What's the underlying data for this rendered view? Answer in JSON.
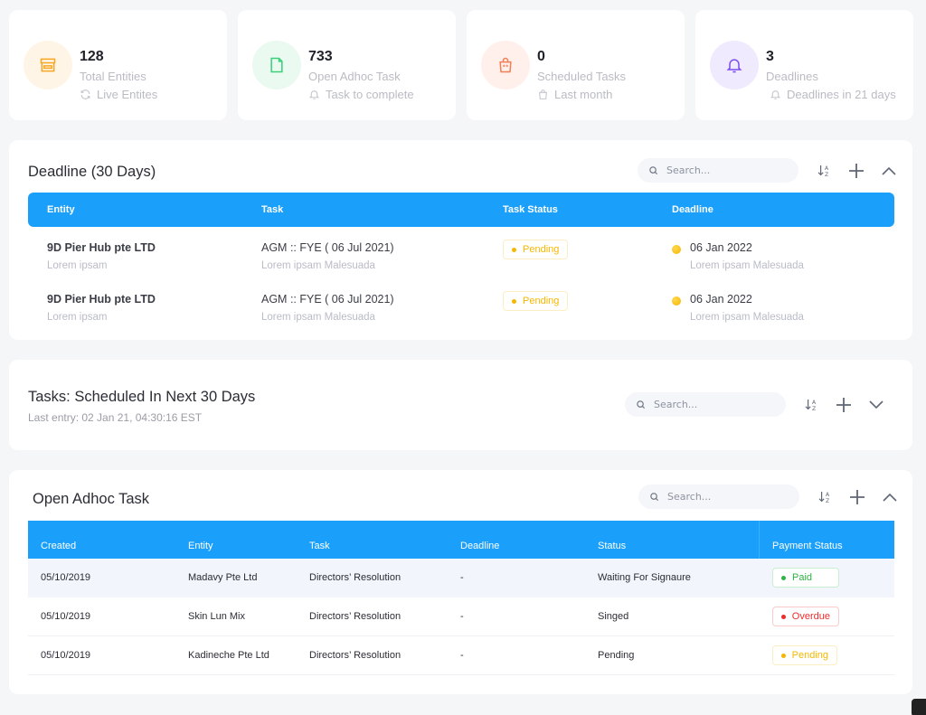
{
  "stats": [
    {
      "value": "128",
      "label": "Total Entities",
      "sub": "Live Entites",
      "icon": "store-icon",
      "sub_icon": "refresh-icon",
      "color": "#f6a623",
      "bg": "#fff5e6"
    },
    {
      "value": "733",
      "label": "Open Adhoc Task",
      "sub": "Task to complete",
      "icon": "file-icon",
      "sub_icon": "bell-icon",
      "color": "#3ccf7a",
      "bg": "#eafaf0"
    },
    {
      "value": "0",
      "label": "Scheduled Tasks",
      "sub": "Last month",
      "icon": "bag-icon",
      "sub_icon": "bag-icon",
      "color": "#f27e58",
      "bg": "#fff0eb"
    },
    {
      "value": "3",
      "label": "Deadlines",
      "sub": "Deadlines in 21 days",
      "icon": "bell-icon",
      "sub_icon": "bell-icon",
      "color": "#7a4df0",
      "bg": "#efeafd"
    }
  ],
  "search_placeholder": "Search...",
  "deadline": {
    "title": "Deadline (30 Days)",
    "columns": [
      "Entity",
      "Task",
      "Task Status",
      "Deadline"
    ],
    "rows": [
      {
        "entity": "9D Pier Hub pte LTD",
        "entity_sub": "Lorem ipsam",
        "task": "AGM :: FYE ( 06 Jul 2021)",
        "task_sub": "Lorem ipsam Malesuada",
        "status": "Pending",
        "deadline": "06 Jan 2022",
        "deadline_sub": "Lorem ipsam Malesuada"
      },
      {
        "entity": "9D Pier Hub pte LTD",
        "entity_sub": "Lorem ipsam",
        "task": "AGM :: FYE ( 06 Jul 2021)",
        "task_sub": "Lorem ipsam Malesuada",
        "status": "Pending",
        "deadline": "06 Jan 2022",
        "deadline_sub": "Lorem ipsam Malesuada"
      }
    ]
  },
  "scheduled": {
    "title": "Tasks: Scheduled In Next 30 Days",
    "last_entry": "Last entry: 02 Jan 21, 04:30:16 EST"
  },
  "adhoc": {
    "title": "Open Adhoc Task",
    "columns": [
      "Created",
      "Entity",
      "Task",
      "Deadline",
      "Status",
      "Payment Status"
    ],
    "rows": [
      {
        "created": "05/10/2019",
        "entity": "Madavy Pte Ltd",
        "task": "Directors’ Resolution",
        "deadline": "-",
        "status": "Waiting For Signaure",
        "payment": "Paid",
        "payment_type": "paid"
      },
      {
        "created": "05/10/2019",
        "entity": "Skin Lun Mix",
        "task": "Directors’ Resolution",
        "deadline": "-",
        "status": "Singed",
        "payment": "Overdue",
        "payment_type": "overdue"
      },
      {
        "created": "05/10/2019",
        "entity": "Kadineche Pte Ltd",
        "task": "Directors’ Resolution",
        "deadline": "-",
        "status": "Pending",
        "payment": "Pending",
        "payment_type": "pending"
      }
    ]
  },
  "colors": {
    "accent": "#1a9ffa",
    "pending": "#f5b800",
    "paid": "#2fb344",
    "overdue": "#ee2d2d"
  }
}
